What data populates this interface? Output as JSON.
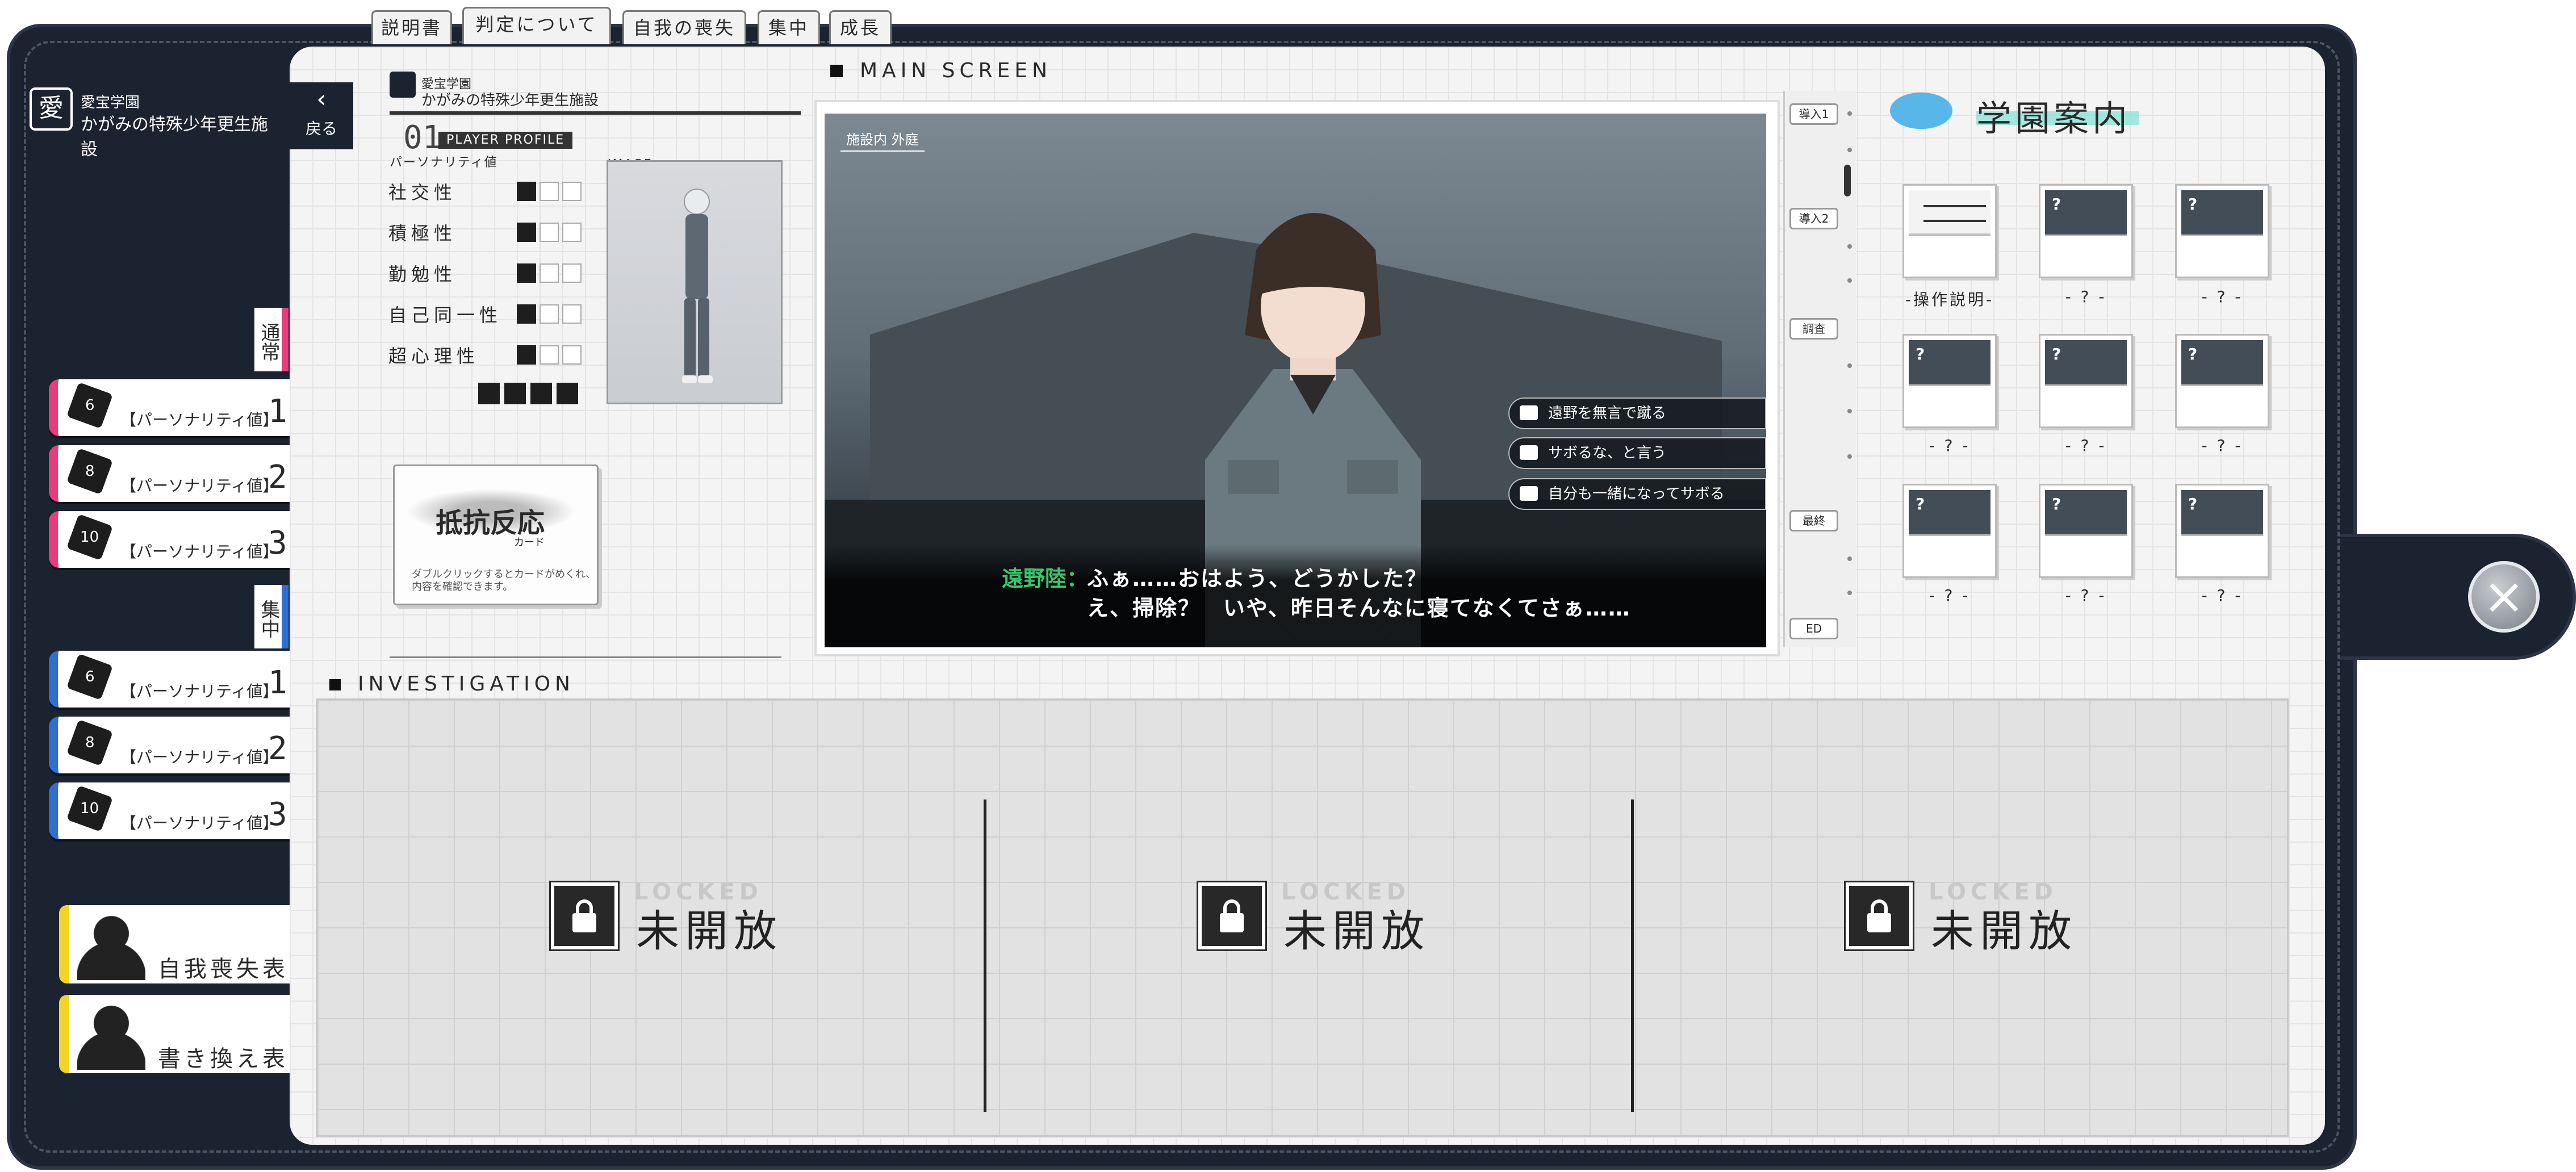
{
  "top_tabs": [
    "説明書",
    "判定について",
    "自我の喪失",
    "集中",
    "成長"
  ],
  "logo": {
    "line1": "愛宝学園",
    "line2": "かがみの特殊少年更生施設",
    "mark": "愛"
  },
  "back_button": {
    "label": "戻る"
  },
  "side_sections": {
    "normal_label": "通常",
    "focus_label": "集中",
    "normal_dice": [
      {
        "die": "6",
        "label": "【パーソナリティ値】",
        "num": "1"
      },
      {
        "die": "8",
        "label": "【パーソナリティ値】",
        "num": "2"
      },
      {
        "die": "10",
        "label": "【パーソナリティ値】",
        "num": "3"
      }
    ],
    "focus_dice": [
      {
        "die": "6",
        "label": "【パーソナリティ値】",
        "num": "1"
      },
      {
        "die": "8",
        "label": "【パーソナリティ値】",
        "num": "2"
      },
      {
        "die": "10",
        "label": "【パーソナリティ値】",
        "num": "3"
      }
    ],
    "big_buttons": [
      "自我喪失表",
      "書き換え表"
    ]
  },
  "profile": {
    "header_line1": "愛宝学園",
    "header_line2": "かがみの特殊少年更生施設",
    "number": "01",
    "badge": "PLAYER PROFILE",
    "personality_label": "パーソナリティ値",
    "image_label": "IMAGE",
    "stats": [
      {
        "name": "社交性",
        "filled": 1
      },
      {
        "name": "積極性",
        "filled": 1
      },
      {
        "name": "勤勉性",
        "filled": 1
      },
      {
        "name": "自己同一性",
        "filled": 1
      },
      {
        "name": "超心理性",
        "filled": 1
      }
    ],
    "total_filled": 4,
    "card": {
      "title": "抵抗反応",
      "subtitle": "カード",
      "note_line1": "ダブルクリックするとカードがめくれ、",
      "note_line2": "内容を確認できます。"
    }
  },
  "main_screen": {
    "label": "MAIN SCREEN",
    "location": "施設内 外庭",
    "choices": [
      "遠野を無言で蹴る",
      "サボるな、と言う",
      "自分も一緒になってサボる"
    ],
    "speaker": "遠野陸：",
    "line1": "ふぁ……おはよう、どうかした？",
    "line2": "え、掃除？　いや、昨日そんなに寝てなくてさぁ……",
    "chapters": [
      "導入1",
      "導入2",
      "調査",
      "最終",
      "ED"
    ]
  },
  "guide": {
    "title": "学園案内",
    "envelopes": [
      {
        "label": "-操作説明-",
        "open": true
      },
      {
        "label": "- ? -",
        "open": false
      },
      {
        "label": "- ? -",
        "open": false
      },
      {
        "label": "- ? -",
        "open": false
      },
      {
        "label": "- ? -",
        "open": false
      },
      {
        "label": "- ? -",
        "open": false
      },
      {
        "label": "- ? -",
        "open": false
      },
      {
        "label": "- ? -",
        "open": false
      },
      {
        "label": "- ? -",
        "open": false
      }
    ]
  },
  "investigation": {
    "label": "INVESTIGATION",
    "slots": [
      {
        "ghost": "LOCKED",
        "text": "未開放"
      },
      {
        "ghost": "LOCKED",
        "text": "未開放"
      },
      {
        "ghost": "LOCKED",
        "text": "未開放"
      }
    ]
  },
  "close_button": {
    "label": "×"
  },
  "colors": {
    "cover": "#1b2230",
    "pink": "#e83c7c",
    "blue": "#2e6fd1",
    "yellow": "#f2d524",
    "speaker": "#35c96f"
  }
}
